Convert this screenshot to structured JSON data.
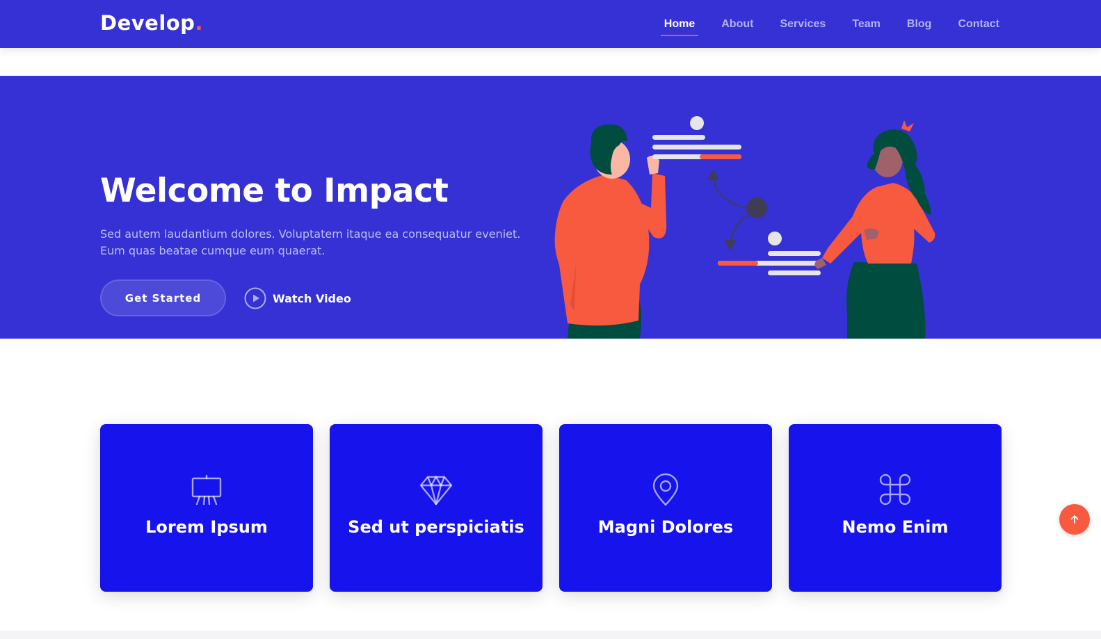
{
  "header": {
    "logo_text": "Develop",
    "logo_dot": ".",
    "nav": [
      {
        "label": "Home",
        "active": true
      },
      {
        "label": "About"
      },
      {
        "label": "Services"
      },
      {
        "label": "Team"
      },
      {
        "label": "Blog"
      },
      {
        "label": "Contact"
      }
    ]
  },
  "hero": {
    "title": "Welcome to Impact",
    "text": "Sed autem laudantium dolores. Voluptatem itaque ea consequatur eveniet. Eum quas beatae cumque eum quaerat.",
    "primary_button": "Get Started",
    "video_button": "Watch Video",
    "illustration": "two-people-collaborating-illustration"
  },
  "features": [
    {
      "title": "Lorem Ipsum",
      "icon": "easel-icon"
    },
    {
      "title": "Sed ut perspiciatis",
      "icon": "gem-icon"
    },
    {
      "title": "Magni Dolores",
      "icon": "map-pin-icon"
    },
    {
      "title": "Nemo Enim",
      "icon": "command-icon"
    }
  ],
  "scroll_top": {
    "icon": "arrow-up-icon"
  },
  "colors": {
    "header_bg": "#3531d4",
    "hero_bg": "#3531d4",
    "card_bg": "#1613ec",
    "accent": "#f85a40",
    "text_light": "#ffffff"
  }
}
